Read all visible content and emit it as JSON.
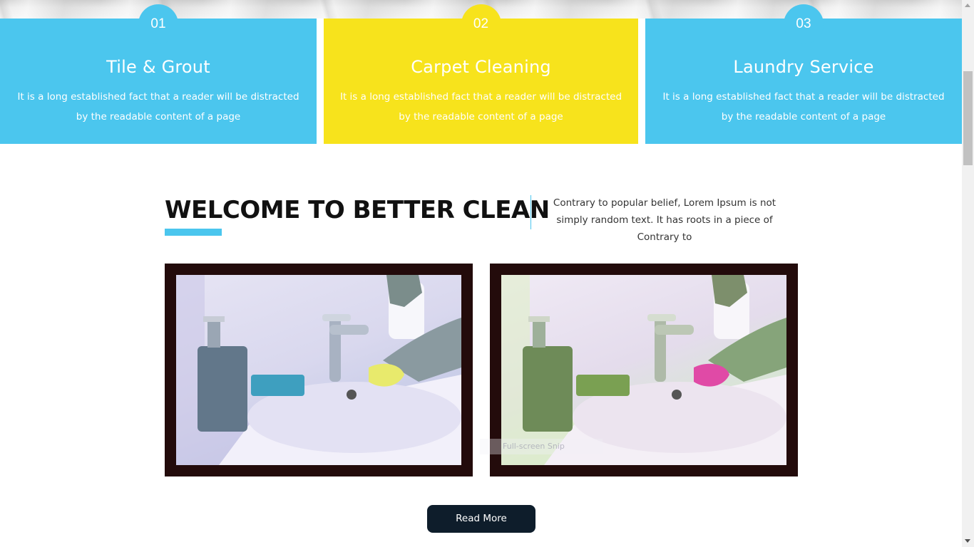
{
  "services": [
    {
      "number": "01",
      "title": "Tile & Grout",
      "description": "It is a long established fact that a reader will be distracted by the readable content of a page",
      "color": "#4bc6ee"
    },
    {
      "number": "02",
      "title": "Carpet Cleaning",
      "description": "It is a long established fact that a reader will be distracted by the readable content of a page",
      "color": "#f7e31c"
    },
    {
      "number": "03",
      "title": "Laundry Service",
      "description": "It is a long established fact that a reader will be distracted by the readable content of a page",
      "color": "#4bc6ee"
    }
  ],
  "welcome": {
    "title": "WELCOME TO BETTER CLEAN",
    "text": "Contrary to popular belief, Lorem Ipsum is not simply random text. It has roots in a piece of Contrary to"
  },
  "gallery": {
    "images": [
      {
        "icon": "bathroom-sink-cleaning-photo"
      },
      {
        "icon": "bathroom-sink-cleaning-photo"
      }
    ],
    "overlay_text": "Full-screen Snip"
  },
  "read_more": {
    "label": "Read More"
  },
  "colors": {
    "accent_blue": "#4bc6ee",
    "accent_yellow": "#f7e31c",
    "dark_button": "#0e1d2b",
    "frame": "#230b0b"
  }
}
